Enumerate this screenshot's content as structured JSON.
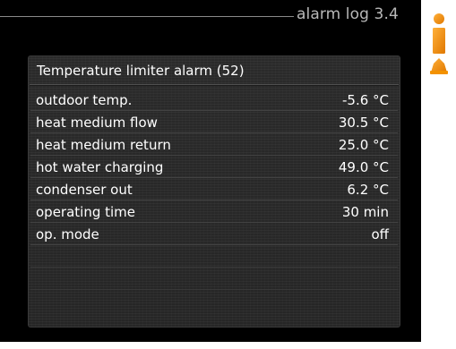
{
  "header": {
    "title": "alarm log 3.4"
  },
  "alarm": {
    "title": "Temperature limiter alarm (52)"
  },
  "rows": [
    {
      "label": "outdoor temp.",
      "value": "-5.6  °C"
    },
    {
      "label": "heat medium flow",
      "value": "30.5  °C"
    },
    {
      "label": "heat medium return",
      "value": "25.0  °C"
    },
    {
      "label": "hot water charging",
      "value": "49.0  °C"
    },
    {
      "label": "condenser out",
      "value": "6.2 °C"
    },
    {
      "label": "operating time",
      "value": "30 min"
    },
    {
      "label": "op. mode",
      "value": "off"
    }
  ],
  "icons": {
    "info": "info-icon",
    "color": "#f39200"
  },
  "colors": {
    "background": "#000000",
    "panel": "#282828",
    "text": "#ffffff",
    "header_text": "#b8b8b8",
    "accent": "#f39200"
  }
}
